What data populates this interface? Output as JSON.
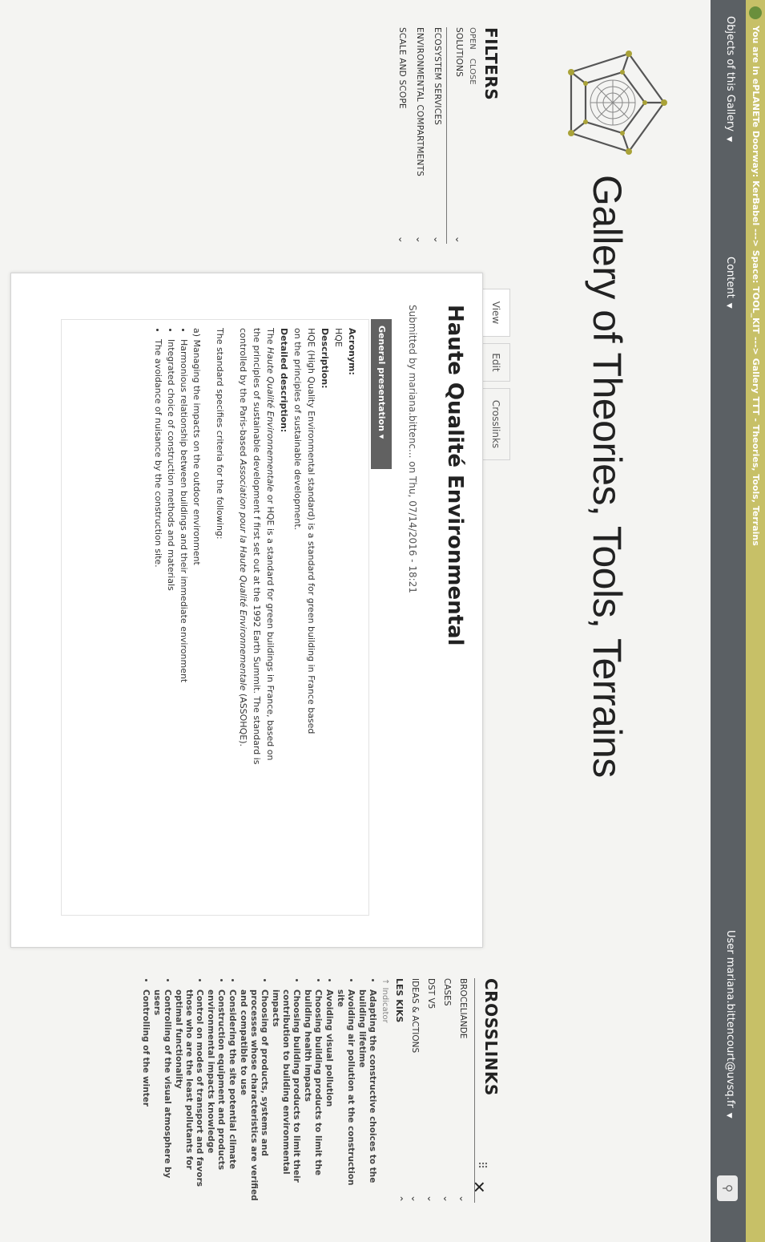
{
  "notice": {
    "text": "You are in ePLANETe Doorway: KerBabel ---> Space: TOOL_KIT ---> Gallery TTT - Theories, Tools, Terrains"
  },
  "menu": {
    "objects": "Objects of this Gallery",
    "content": "Content",
    "user": "User mariana.bittencourt@uvsq.fr"
  },
  "site_title": "Gallery of Theories, Tools, Terrains",
  "filters": {
    "title": "FILTERS",
    "open": "OPEN",
    "close": "CLOSE",
    "items": [
      {
        "label": "SOLUTIONS"
      },
      {
        "label": "ECOSYSTEM SERVICES"
      },
      {
        "label": "ENVIRONMENTAL COMPARTMENTS"
      },
      {
        "label": "SCALE AND SCOPE"
      }
    ]
  },
  "tabs": [
    {
      "label": "View"
    },
    {
      "label": "Edit"
    },
    {
      "label": "Crosslinks"
    }
  ],
  "node": {
    "title": "Haute Qualité Environmental",
    "submitted": "Submitted by mariana.bittenc... on Thu, 07/14/2016 - 18:21",
    "section": "General presentation",
    "acronym_label": "Acronym:",
    "acronym": "HQE",
    "description_label": "Description:",
    "description_1": "HQE (High Quality Environmental standard) is a standard for green building in France based",
    "description_2": "on the principles of sustainable development.",
    "detailed_label": "Detailed description:",
    "detailed_1a": "The ",
    "detailed_1b": "Haute Qualité Environnementale",
    "detailed_1c": " or HQE  is a standard for green buildings in France, based on",
    "detailed_2": "the principles of sustainable development f first set out at the 1992 Earth Summit. The standard is",
    "detailed_3a": "controlled by the Paris-based ",
    "detailed_3b": "Association pour la Haute Qualité Environnementale",
    "detailed_3c": " (ASSOHQE).",
    "criteria": "The standard specifies criteria for the following:",
    "section_a": "a) Managing the impacts on the outdoor environment",
    "bullets": [
      "Harmonious relationship between buildings and their immediate environment",
      "Integrated choice of construction methods and materials",
      "The avoidance of nuisance by the construction site."
    ]
  },
  "crosslinks": {
    "title": "CROSSLINKS",
    "items": [
      {
        "label": "BROCELIANDE"
      },
      {
        "label": "CASES"
      },
      {
        "label": "DST V5"
      },
      {
        "label": "IDEAS & ACTIONS"
      }
    ],
    "kiks_title": "LES KIKS",
    "kiks_sub": "Indicator",
    "kiks": [
      "Adapting the constructive choices to the building lifetime",
      "Avoiding air pollution at the construction site",
      "Avoiding visual pollution",
      "Choosing building products to limit the building health impacts",
      "Choosing building products to limit their contribution to building environmental impacts",
      "Choosing of products, systems and processes whose characteristics are verified and compatible to use",
      "Considering the site potential climate",
      "Construction equipment and products environmental impacts knowledge",
      "Control on modes of transport and favors those who are the least pollutants for optimal functionality",
      "Controlling of the visual atmosphere by users",
      "Controlling of the winter"
    ]
  }
}
